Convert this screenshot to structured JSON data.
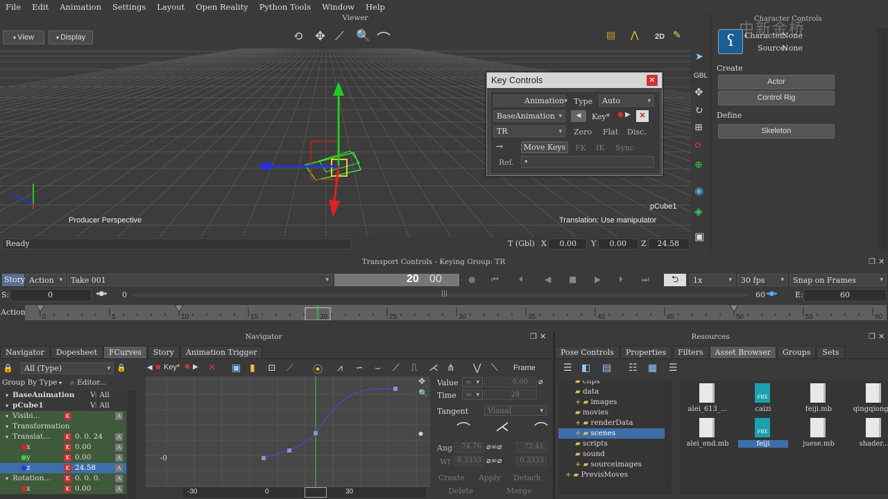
{
  "menu": [
    "File",
    "Edit",
    "Animation",
    "Settings",
    "Layout",
    "Open Reality",
    "Python Tools",
    "Window",
    "Help"
  ],
  "viewer": {
    "title": "Viewer",
    "view_label": "View",
    "display_label": "Display",
    "camera_label": "Producer Perspective",
    "object_label": "pCube1",
    "hint": "Translation: Use manipulator",
    "status": "Ready",
    "coord_mode": "T (Gbl)",
    "x_label": "X",
    "x": "0.00",
    "y_label": "Y",
    "y": "0.00",
    "z_label": "Z",
    "z": "24.58",
    "side_gbl": "GBL",
    "mode_2d": "2D"
  },
  "key_controls": {
    "title": "Key Controls",
    "animation_label": "Animation",
    "type_label": "Type",
    "type_value": "Auto",
    "layer_value": "BaseAnimation",
    "key_label": "Key*",
    "channel_value": "TR",
    "zero": "Zero",
    "flat": "Flat",
    "disc": "Disc.",
    "move_keys": "Move Keys",
    "fk": "FK",
    "ik": "IK",
    "sync": "Sync",
    "ref_label": "Ref."
  },
  "character_controls": {
    "title": "Character Controls",
    "character_label": "Character:",
    "character_value": "None",
    "source_label": "Source:",
    "source_value": "None",
    "create_label": "Create",
    "actor": "Actor",
    "control_rig": "Control Rig",
    "define_label": "Define",
    "skeleton": "Skeleton",
    "watermark": "中新金桥"
  },
  "transport": {
    "title": "Transport Controls  -  Keying Group: TR",
    "story": "Story",
    "action": "Action",
    "take": "Take 001",
    "frame_display": "20",
    "frame_display_2": "00",
    "speed": "1x",
    "fps": "30 fps",
    "snap": "Snap on Frames",
    "start_label": "S:",
    "start_value": "0",
    "start_range": "0",
    "end_range": "60",
    "end_label": "E:",
    "end_value": "60",
    "track_label": "Action",
    "ticks": [
      "0",
      "5",
      "10",
      "15",
      "20",
      "25",
      "30",
      "35",
      "40",
      "45",
      "50",
      "55",
      "60"
    ],
    "current_frame": "20"
  },
  "navigator": {
    "title": "Navigator",
    "tabs": [
      "Navigator",
      "Dopesheet",
      "FCurves",
      "Story",
      "Animation Trigger"
    ],
    "active_tab": "FCurves",
    "filter": "All (Type)",
    "group_by": "Group By Type",
    "editor": "Editor...",
    "key_label": "Key*",
    "frame_label": "Frame",
    "tree": [
      {
        "label": "BaseAnimation",
        "value": "V: All",
        "level": 0
      },
      {
        "label": "pCube1",
        "value": "V: All",
        "level": 0
      },
      {
        "label": "Visibi...",
        "value": "",
        "level": 1
      },
      {
        "label": "Transformation",
        "value": "",
        "level": 1
      },
      {
        "label": "Translat...",
        "value": "0. 0. 24",
        "level": 1
      },
      {
        "label": "x",
        "value": "0.00",
        "level": 2
      },
      {
        "label": "y",
        "value": "0.00",
        "level": 2
      },
      {
        "label": "z",
        "value": "24.58",
        "level": 2
      },
      {
        "label": "Rotation...",
        "value": "0. 0. 0.",
        "level": 1
      },
      {
        "label": "x",
        "value": "0.00",
        "level": 2
      }
    ],
    "graph_x_labels": [
      "-30",
      "0",
      "30"
    ],
    "graph_y_label": "-0",
    "value_label": "Value",
    "value_val": "0.00",
    "time_label": "Time",
    "time_val": "28",
    "tangent_label": "Tangent",
    "tangent_val": "Visual",
    "ang_label": "Ang",
    "ang_left": "-74.76",
    "ang_right": "72.41",
    "wt_label": "Wt",
    "wt_left": "0.3333",
    "wt_right": "0.3333",
    "create": "Create",
    "apply": "Apply",
    "detach": "Detach",
    "delete": "Delete",
    "merge": "Merge"
  },
  "resources": {
    "title": "Resources",
    "tabs": [
      "Pose Controls",
      "Properties",
      "Filters",
      "Asset Browser",
      "Groups",
      "Sets"
    ],
    "active_tab": "Asset Browser",
    "folders": [
      "clips",
      "data",
      "images",
      "movies",
      "renderData",
      "scenes",
      "scripts",
      "sound",
      "sourceimages",
      "PrevisMoves"
    ],
    "selected_folder": "scenes",
    "files": [
      {
        "name": "alei_613_...",
        "type": "doc"
      },
      {
        "name": "caizi",
        "type": "fbx"
      },
      {
        "name": "feiji.mb",
        "type": "doc"
      },
      {
        "name": "qingqiong...",
        "type": "doc"
      },
      {
        "name": "alei_end.mb",
        "type": "doc"
      },
      {
        "name": "feiji",
        "type": "fbx",
        "selected": true
      },
      {
        "name": "juese.mb",
        "type": "doc"
      },
      {
        "name": "shader...",
        "type": "doc"
      }
    ],
    "fbx_badge": "FBX"
  }
}
